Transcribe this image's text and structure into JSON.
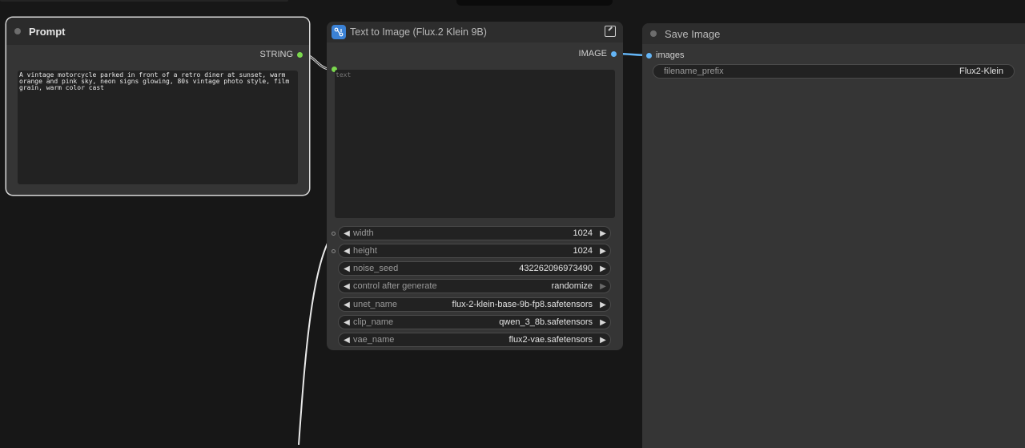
{
  "prompt_node": {
    "title": "Prompt",
    "output_label": "STRING",
    "text": "A vintage motorcycle parked in front of a retro diner at sunset, warm orange and pink sky, neon signs glowing, 80s vintage photo style, film grain, warm color cast"
  },
  "t2i_node": {
    "title": "Text to Image (Flux.2 Klein 9B)",
    "output_label": "IMAGE",
    "text_placeholder": "text",
    "widgets": [
      {
        "label": "width",
        "value": "1024"
      },
      {
        "label": "height",
        "value": "1024"
      },
      {
        "label": "noise_seed",
        "value": "432262096973490"
      },
      {
        "label": "control after generate",
        "value": "randomize"
      },
      {
        "label": "unet_name",
        "value": "flux-2-klein-base-9b-fp8.safetensors"
      },
      {
        "label": "clip_name",
        "value": "qwen_3_8b.safetensors"
      },
      {
        "label": "vae_name",
        "value": "flux2-vae.safetensors"
      }
    ]
  },
  "save_node": {
    "title": "Save Image",
    "input_label": "images",
    "filename_prefix_label": "filename_prefix",
    "filename_prefix_value": "Flux2-Klein"
  },
  "colors": {
    "string_slot": "#7bd84e",
    "image_slot": "#64b5f6",
    "app_icon": "#3b82d6"
  }
}
